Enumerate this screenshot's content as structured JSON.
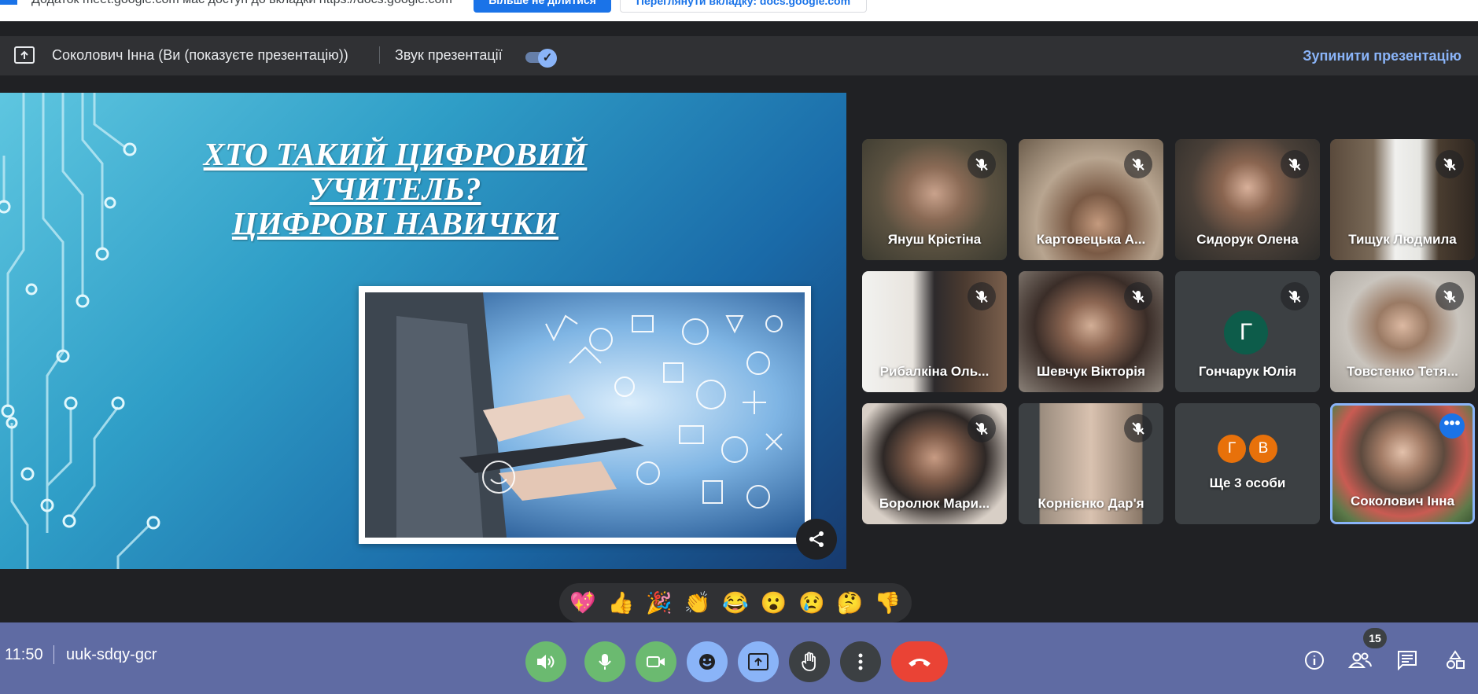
{
  "notification": {
    "message": "Додаток meet.google.com має доступ до вкладки https://docs.google.com",
    "primary_label": "Більше не ділитися",
    "secondary_label": "Переглянути вкладку: docs.google.com"
  },
  "presentation_bar": {
    "presenter": "Соколович Інна (Ви (показуєте презентацію))",
    "sound_label": "Звук презентації",
    "sound_on": true,
    "stop_label": "Зупинити презентацію"
  },
  "slide": {
    "title_line1": "ХТО ТАКИЙ ЦИФРОВИЙ",
    "title_line2": "УЧИТЕЛЬ?",
    "title_line3": "ЦИФРОВІ НАВИЧКИ"
  },
  "participants": [
    {
      "name": "Януш Крістіна",
      "muted": true
    },
    {
      "name": "Картовецька А...",
      "muted": true
    },
    {
      "name": "Сидорук Олена",
      "muted": true
    },
    {
      "name": "Тищук Людмила",
      "muted": true
    },
    {
      "name": "Рибалкіна Оль...",
      "muted": true
    },
    {
      "name": "Шевчук Вікторія",
      "muted": true
    },
    {
      "name": "Гончарук Юлія",
      "muted": true,
      "avatar_letter": "Г"
    },
    {
      "name": "Товстенко Тетя...",
      "muted": true
    },
    {
      "name": "Боролюк Мари...",
      "muted": true
    },
    {
      "name": "Корнієнко Дар'я",
      "muted": true
    },
    {
      "name": "Ще 3 особи",
      "mini_avatars": [
        "Г",
        "В"
      ]
    },
    {
      "name": "Соколович Інна",
      "self": true
    }
  ],
  "reactions": [
    "💖",
    "👍",
    "🎉",
    "👏",
    "😂",
    "😮",
    "😢",
    "🤔",
    "👎"
  ],
  "bottom_bar": {
    "time": "11:50",
    "meeting_code": "uuk-sdqy-gcr",
    "participant_count": "15"
  },
  "colors": {
    "accent": "#8ab4f8",
    "bottom_bar": "#5f6ba3",
    "end_call": "#ea4335",
    "active_green": "#6bba70"
  }
}
